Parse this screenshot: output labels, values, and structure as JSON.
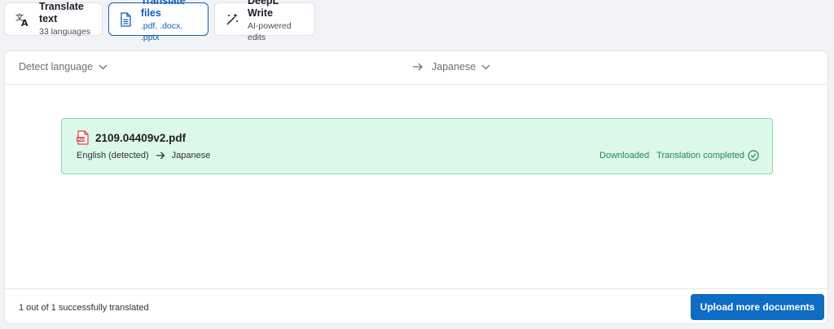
{
  "tabs": [
    {
      "title": "Translate text",
      "subtitle": "33 languages",
      "icon": "translate-icon",
      "active": false
    },
    {
      "title": "Translate files",
      "subtitle": ".pdf, .docx, .pptx",
      "icon": "document-icon",
      "active": true
    },
    {
      "title": "DeepL Write",
      "subtitle": "AI-powered edits",
      "icon": "magic-wand-icon",
      "active": false
    }
  ],
  "language_bar": {
    "source": "Detect language",
    "target": "Japanese"
  },
  "file": {
    "name": "2109.04409v2.pdf",
    "icon": "pdf-file-icon",
    "source_lang": "English (detected)",
    "target_lang": "Japanese",
    "download_status": "Downloaded",
    "translation_status": "Translation completed"
  },
  "footer": {
    "summary": "1 out of 1 successfully translated",
    "upload_label": "Upload more documents"
  },
  "colors": {
    "accent": "#0f6cc3",
    "active_tab": "#0f5fb8",
    "success_bg": "#dcf8e9",
    "success_border": "#7fdca8",
    "success_text": "#1f8a4f"
  }
}
